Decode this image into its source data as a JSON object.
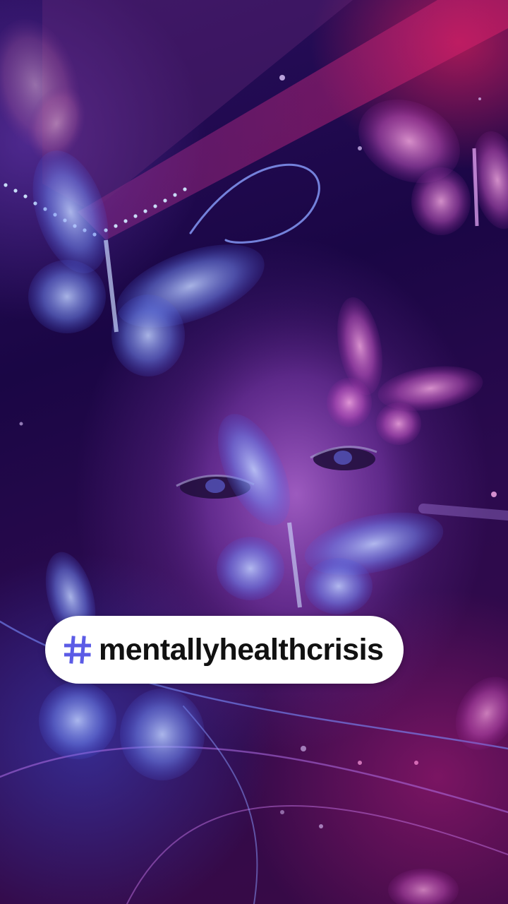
{
  "video": {
    "scene_description_icon": "butterfly-filter-background"
  },
  "hashtag": {
    "icon": "hash-icon",
    "icon_color": "#5B5BE6",
    "text": "mentallyhealthcrisis"
  },
  "colors": {
    "background_deep": "#1a0645",
    "accent_magenta": "#d21e5a",
    "accent_blue": "#4a5be0",
    "pill_background": "#ffffff",
    "pill_text": "#111111"
  }
}
